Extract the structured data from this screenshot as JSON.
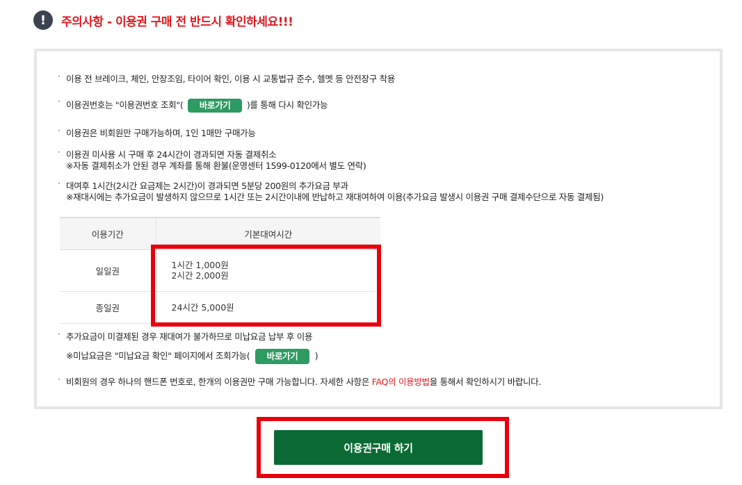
{
  "notice": {
    "icon_glyph": "!",
    "title": "주의사항 - 이용권 구매 전 반드시 확인하세요!!!",
    "title_color": "#e3161d"
  },
  "bullets": {
    "dot": "·",
    "b1": "이용 전 브레이크, 체인, 안장조임, 타이어 확인, 이용 시 교통법규 준수, 헬멧 등 안전장구 착용",
    "b2_before": "이용권번호는 \"이용권번호 조회\"(",
    "b2_button": "바로가기",
    "b2_after": ")를 통해 다시 확인가능",
    "b3": "이용권은 비회원만 구매가능하며, 1인 1매만 구매가능",
    "b4_line1": "이용권 미사용 시 구매 후 24시간이 경과되면 자동 결제취소",
    "b4_line2": "※자동 결제취소가 안된 경우 계좌를 통해 환불(운영센터 1599-0120에서 별도 연락)",
    "b5_line1": "대여후 1시간(2시간 요금제는 2시간)이 경과되면 5분당 200원의 추가요금 부과",
    "b5_line2": "※재대시에는 추가요금이 발생하지 않으므로 1시간 또는 2시간이내에 반납하고 재대여하여 이용(추가요금 발생시 이용권 구매 결제수단으로 자동 결제됨)",
    "b6_line1": "추가요금이 미결제된 경우 재대여가 불가하므로 미납요금 납부 후 이용",
    "b6_line2_before": "※미납요금은 \"미납요금 확인\" 페이지에서 조회가능(",
    "b6_button": "바로가기",
    "b6_line2_after": ")",
    "b7_before": "비회원의 경우 하나의 핸드폰 번호로, 한개의 이용권만 구매 가능합니다. 자세한 사항은 ",
    "b7_link": "FAQ의 이용방법",
    "b7_after": "을 통해서 확인하시기 바랍니다."
  },
  "fee_table": {
    "headers": [
      "이용기간",
      "기본대여시간"
    ],
    "rows": [
      {
        "period": "일일권",
        "line1": "1시간 1,000원",
        "line2": "2시간 2,000원"
      },
      {
        "period": "종일권",
        "line1": "24시간 5,000원"
      }
    ]
  },
  "purchase_button": "이용권구매 하기",
  "colors": {
    "accent_red": "#e3161d",
    "highlight_red": "#e8000b",
    "link_button_green": "#2e9b62",
    "purchase_green": "#0a6a33"
  }
}
